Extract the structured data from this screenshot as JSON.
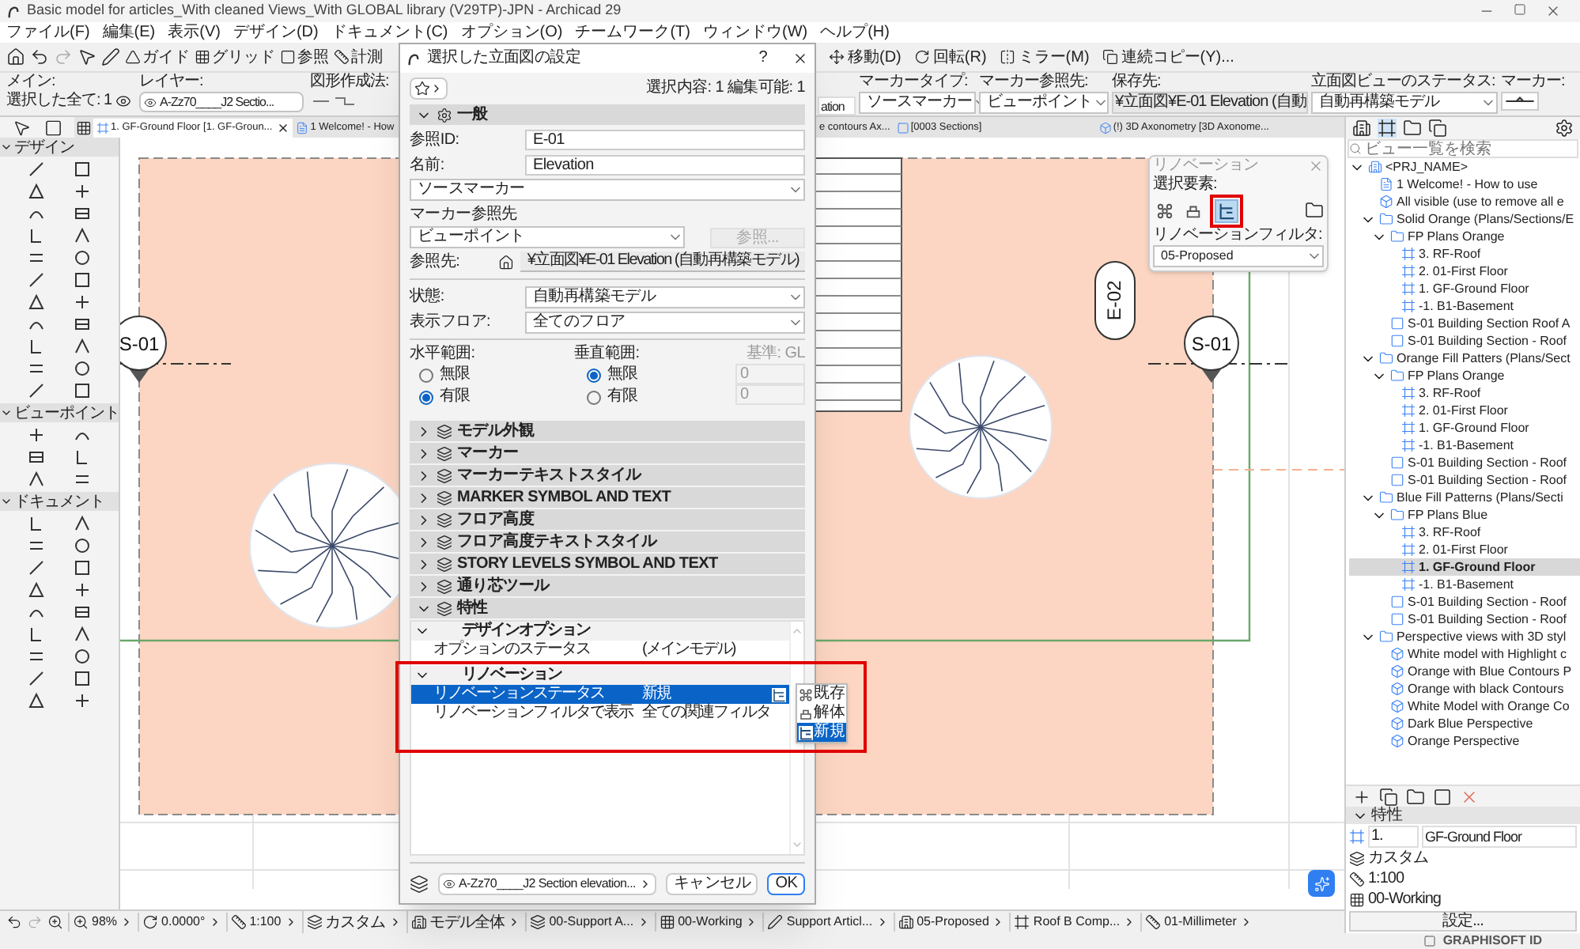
{
  "window": {
    "title": "Basic model for articles_With cleaned Views_With GLOBAL library (V29TP)-JPN - Archicad 29"
  },
  "menu": [
    "ファイル(F)",
    "編集(E)",
    "表示(V)",
    "デザイン(D)",
    "ドキュメント(C)",
    "オプション(O)",
    "チームワーク(T)",
    "ウィンドウ(W)",
    "ヘルプ(H)"
  ],
  "toolbar": {
    "left": [
      {
        "label": "ガイド",
        "kind": "guide"
      },
      {
        "label": "グリッド",
        "kind": "grid"
      },
      {
        "label": "参照",
        "kind": "trace"
      },
      {
        "label": "計測",
        "kind": "measure"
      }
    ],
    "right": [
      {
        "label": "移動(D)",
        "kind": "move"
      },
      {
        "label": "回転(R)",
        "kind": "rotate"
      },
      {
        "label": "ミラー(M)",
        "kind": "mirror"
      },
      {
        "label": "連続コピー(Y)...",
        "kind": "copy"
      }
    ]
  },
  "info_box": {
    "main_label": "メイン:",
    "selected": "選択した全て: 1",
    "layer_label": "レイヤー:",
    "layer": "A-Zz70____J2 Sectio...",
    "geometry_label": "図形作成法:",
    "name_value": "ation",
    "marker_type_label": "マーカータイプ:",
    "marker_type": "ソースマーカー",
    "marker_ref_label": "マーカー参照先:",
    "marker_ref": "ビューポイント",
    "save_label": "保存先:",
    "save_path": "¥立面図¥E-01 Elevation (自動",
    "status_label": "立面図ビューのステータス:",
    "status": "自動再構築モデル",
    "marker_label": "マーカー:"
  },
  "tabs": [
    {
      "label": "1. GF-Ground Floor [1. GF-Groun...",
      "kind": "plan",
      "selected": true
    },
    {
      "label": "1 Welcome! - How",
      "kind": "layout",
      "selected": false
    },
    {
      "label": "e contours Ax...",
      "kind": "none",
      "selected": false
    },
    {
      "label": "[0003 Sections]",
      "kind": "section",
      "selected": false
    },
    {
      "label": "(!) 3D Axonometry [3D Axonome...",
      "kind": "axonometry",
      "selected": false
    }
  ],
  "toolbox": [
    {
      "title": "デザイン"
    },
    {
      "title": "ビューポイント"
    },
    {
      "title": "ドキュメント"
    }
  ],
  "canvas": {
    "markers": [
      {
        "label": "S-01",
        "kind": "section"
      },
      {
        "label": "E-02",
        "kind": "elevation"
      },
      {
        "label": "S-01",
        "kind": "section"
      }
    ]
  },
  "renovation_palette": {
    "title": "リノベーション",
    "selection_label": "選択要素:",
    "statuses": [
      {
        "kind": "existing",
        "selected": false
      },
      {
        "kind": "demolish",
        "selected": false
      },
      {
        "kind": "new",
        "selected": true
      }
    ],
    "filter_label": "リノベーションフィルタ:",
    "filter": "05-Proposed"
  },
  "dialog": {
    "title": "選択した立面図の設定",
    "help": "?",
    "selection_info": "選択内容: 1 編集可能: 1",
    "general": {
      "title": "一般",
      "expanded": true,
      "ref_id_label": "参照ID:",
      "ref_id": "E-01",
      "name_label": "名前:",
      "name": "Elevation",
      "marker_kind": "ソースマーカー",
      "marker_ref_label": "マーカー参照先",
      "marker_ref": "ビューポイント",
      "browse_button": "参照...",
      "browse_disabled": true,
      "ref_to_label": "参照先:",
      "ref_to": "¥立面図¥E-01 Elevation (自動再構築モデル)",
      "state_label": "状態:",
      "state": "自動再構築モデル",
      "floors_label": "表示フロア:",
      "floors": "全てのフロア",
      "horizontal_label": "水平範囲:",
      "horizontal": [
        {
          "label": "無限",
          "selected": false
        },
        {
          "label": "有限",
          "selected": true
        }
      ],
      "vertical_label": "垂直範囲:",
      "vertical": [
        {
          "label": "無限",
          "selected": true
        },
        {
          "label": "有限",
          "selected": false
        }
      ],
      "base_label": "基準: GL",
      "heights": [
        "0",
        "0"
      ]
    },
    "panels": [
      {
        "title": "モデル外観",
        "expanded": false
      },
      {
        "title": "マーカー",
        "expanded": false
      },
      {
        "title": "マーカーテキストスタイル",
        "expanded": false
      },
      {
        "title": "MARKER SYMBOL AND TEXT",
        "expanded": false
      },
      {
        "title": "フロア高度",
        "expanded": false
      },
      {
        "title": "フロア高度テキストスタイル",
        "expanded": false
      },
      {
        "title": "STORY LEVELS SYMBOL AND TEXT",
        "expanded": false
      },
      {
        "title": "通り芯ツール",
        "expanded": false
      },
      {
        "title": "特性",
        "expanded": true
      }
    ],
    "properties": [
      {
        "group": "デザインオプション",
        "expanded": true,
        "rows": [
          {
            "name": "オプションのステータス",
            "value": "(メインモデル)",
            "selected": false
          }
        ]
      },
      {
        "group": "リノベーション",
        "expanded": true,
        "rows": [
          {
            "name": "リノベーションステータス",
            "value": "新規",
            "selected": true
          },
          {
            "name": "リノベーションフィルタで表示",
            "value": "全ての関連フィルタ",
            "selected": false
          }
        ]
      }
    ],
    "status_menu": [
      {
        "label": "既存",
        "kind": "existing",
        "selected": false
      },
      {
        "label": "解体",
        "kind": "demolish",
        "selected": false
      },
      {
        "label": "新規",
        "kind": "new",
        "selected": true
      }
    ],
    "footer": {
      "layer": "A-Zz70____J2 Section elevation...",
      "cancel": "キャンセル",
      "ok": "OK"
    }
  },
  "navigator": {
    "search_placeholder": "ビュー一覧を検索",
    "tree": [
      {
        "label": "<PRJ_NAME>",
        "kind": "project",
        "expanded": true,
        "selected": false,
        "children": [
          {
            "label": "1 Welcome! - How to use",
            "kind": "layout",
            "selected": false
          },
          {
            "label": "All visible (use to remove all e",
            "kind": "perspective",
            "selected": false
          },
          {
            "label": "Solid Orange (Plans/Sections/E",
            "kind": "folder",
            "expanded": true,
            "selected": false,
            "children": [
              {
                "label": "FP Plans Orange",
                "kind": "planfolder",
                "expanded": true,
                "selected": false,
                "children": [
                  {
                    "label": "3. RF-Roof",
                    "kind": "plan",
                    "selected": false
                  },
                  {
                    "label": "2. 01-First Floor",
                    "kind": "plan",
                    "selected": false
                  },
                  {
                    "label": "1. GF-Ground Floor",
                    "kind": "plan",
                    "selected": false
                  },
                  {
                    "label": "-1. B1-Basement",
                    "kind": "plan",
                    "selected": false
                  }
                ]
              },
              {
                "label": "S-01 Building Section Roof A",
                "kind": "section",
                "selected": false
              },
              {
                "label": "S-01 Building Section - Roof",
                "kind": "section",
                "selected": false
              }
            ]
          },
          {
            "label": "Orange Fill Patters (Plans/Sect",
            "kind": "folder",
            "expanded": true,
            "selected": false,
            "children": [
              {
                "label": "FP Plans Orange",
                "kind": "planfolder",
                "expanded": true,
                "selected": false,
                "children": [
                  {
                    "label": "3. RF-Roof",
                    "kind": "plan",
                    "selected": false
                  },
                  {
                    "label": "2. 01-First Floor",
                    "kind": "plan",
                    "selected": false
                  },
                  {
                    "label": "1. GF-Ground Floor",
                    "kind": "plan",
                    "selected": false
                  },
                  {
                    "label": "-1. B1-Basement",
                    "kind": "plan",
                    "selected": false
                  }
                ]
              },
              {
                "label": "S-01 Building Section - Roof",
                "kind": "section",
                "selected": false
              },
              {
                "label": "S-01 Building Section - Roof",
                "kind": "section",
                "selected": false
              }
            ]
          },
          {
            "label": "Blue Fill Patterns (Plans/Secti",
            "kind": "folder",
            "expanded": true,
            "selected": false,
            "children": [
              {
                "label": "FP Plans Blue",
                "kind": "planfolder",
                "expanded": true,
                "selected": false,
                "children": [
                  {
                    "label": "3. RF-Roof",
                    "kind": "plan",
                    "selected": false
                  },
                  {
                    "label": "2. 01-First Floor",
                    "kind": "plan",
                    "selected": false
                  },
                  {
                    "label": "1. GF-Ground Floor",
                    "kind": "plan",
                    "selected": true
                  },
                  {
                    "label": "-1. B1-Basement",
                    "kind": "plan",
                    "selected": false
                  }
                ]
              },
              {
                "label": "S-01 Building Section - Roof",
                "kind": "section",
                "selected": false
              },
              {
                "label": "S-01 Building Section - Roof",
                "kind": "section",
                "selected": false
              }
            ]
          },
          {
            "label": "Perspective views with 3D styl",
            "kind": "folder",
            "expanded": true,
            "selected": false,
            "children": [
              {
                "label": "White model with Highlight c",
                "kind": "perspective",
                "selected": false
              },
              {
                "label": "Orange with Blue Contours P",
                "kind": "perspective",
                "selected": false
              },
              {
                "label": "Orange with black Contours",
                "kind": "perspective",
                "selected": false
              },
              {
                "label": "White Model with Orange Co",
                "kind": "perspective",
                "selected": false
              },
              {
                "label": "Dark Blue Perspective",
                "kind": "perspective",
                "selected": false
              },
              {
                "label": "Orange Perspective",
                "kind": "perspective",
                "selected": false
              }
            ]
          }
        ]
      }
    ],
    "properties": {
      "title": "特性",
      "expanded": true,
      "id": "1.",
      "name": "GF-Ground Floor",
      "structure": "カスタム",
      "scale": "1:100",
      "layer_combo": "00-Working",
      "settings_button": "設定..."
    }
  },
  "status_bar": [
    {
      "value": "98%",
      "kind": "zoom"
    },
    {
      "value": "0.0000°",
      "kind": "angle"
    },
    {
      "value": "1:100",
      "kind": "scale"
    },
    {
      "value": "カスタム",
      "kind": "structure"
    },
    {
      "value": "モデル全体",
      "kind": "model"
    },
    {
      "value": "00-Support A...",
      "kind": "layer"
    },
    {
      "value": "00-Working",
      "kind": "combo"
    },
    {
      "value": "Support Articl...",
      "kind": "pen"
    },
    {
      "value": "05-Proposed",
      "kind": "renovation"
    },
    {
      "value": "Roof B Comp...",
      "kind": "graphic"
    },
    {
      "value": "01-Millimeter",
      "kind": "dimension"
    }
  ],
  "account": "GRAPHISOFT ID"
}
